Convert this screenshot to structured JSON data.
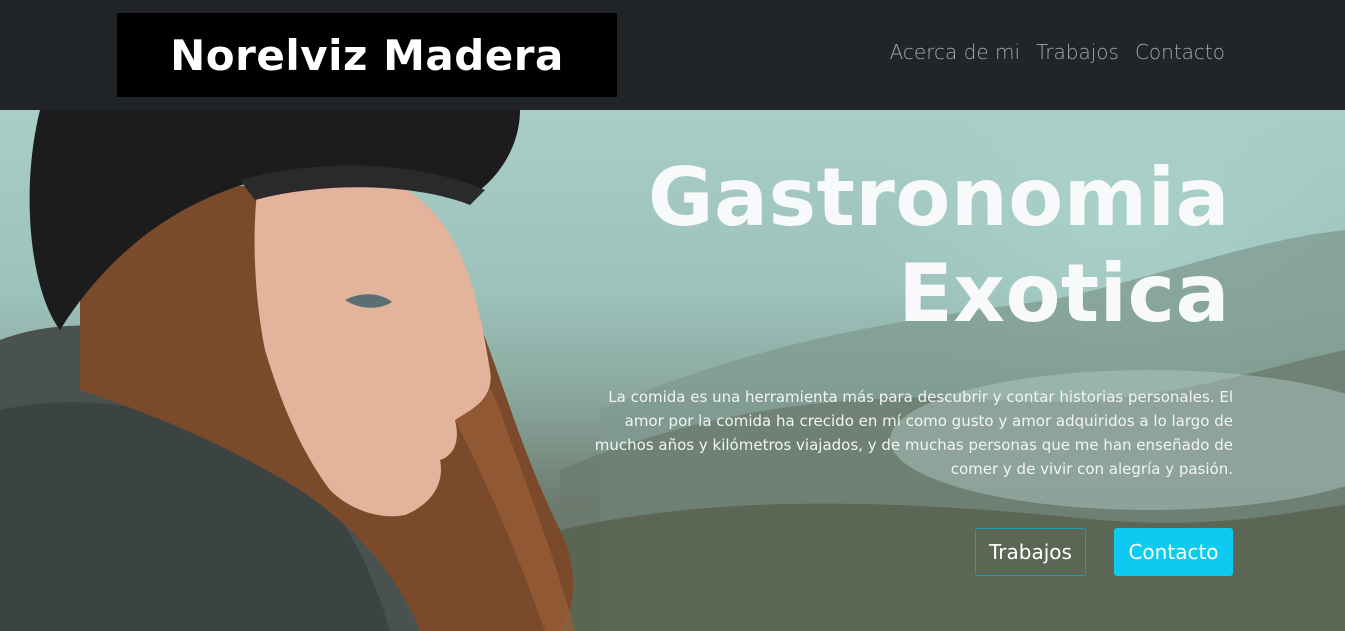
{
  "navbar": {
    "brand": "Norelviz Madera",
    "links": [
      "Acerca de mi",
      "Trabajos",
      "Contacto"
    ]
  },
  "hero": {
    "title_line1": "Gastronomia",
    "title_line2": "Exotica",
    "text": "La comida es una herramienta más para descubrir y contar historias personales. El amor por la comida ha crecido en mí como gusto y amor adquiridos a lo largo de muchos años y kilómetros viajados, y de muchas personas que me han enseñado de comer y de vivir con alegría y pasión.",
    "buttons": {
      "secondary": "Trabajos",
      "primary": "Contacto"
    }
  },
  "colors": {
    "navbar_bg": "#212529",
    "brand_bg": "#000000",
    "nav_link": "#a4a8ad",
    "accent": "#0dcaf0",
    "outline_border": "#17a2b8"
  }
}
